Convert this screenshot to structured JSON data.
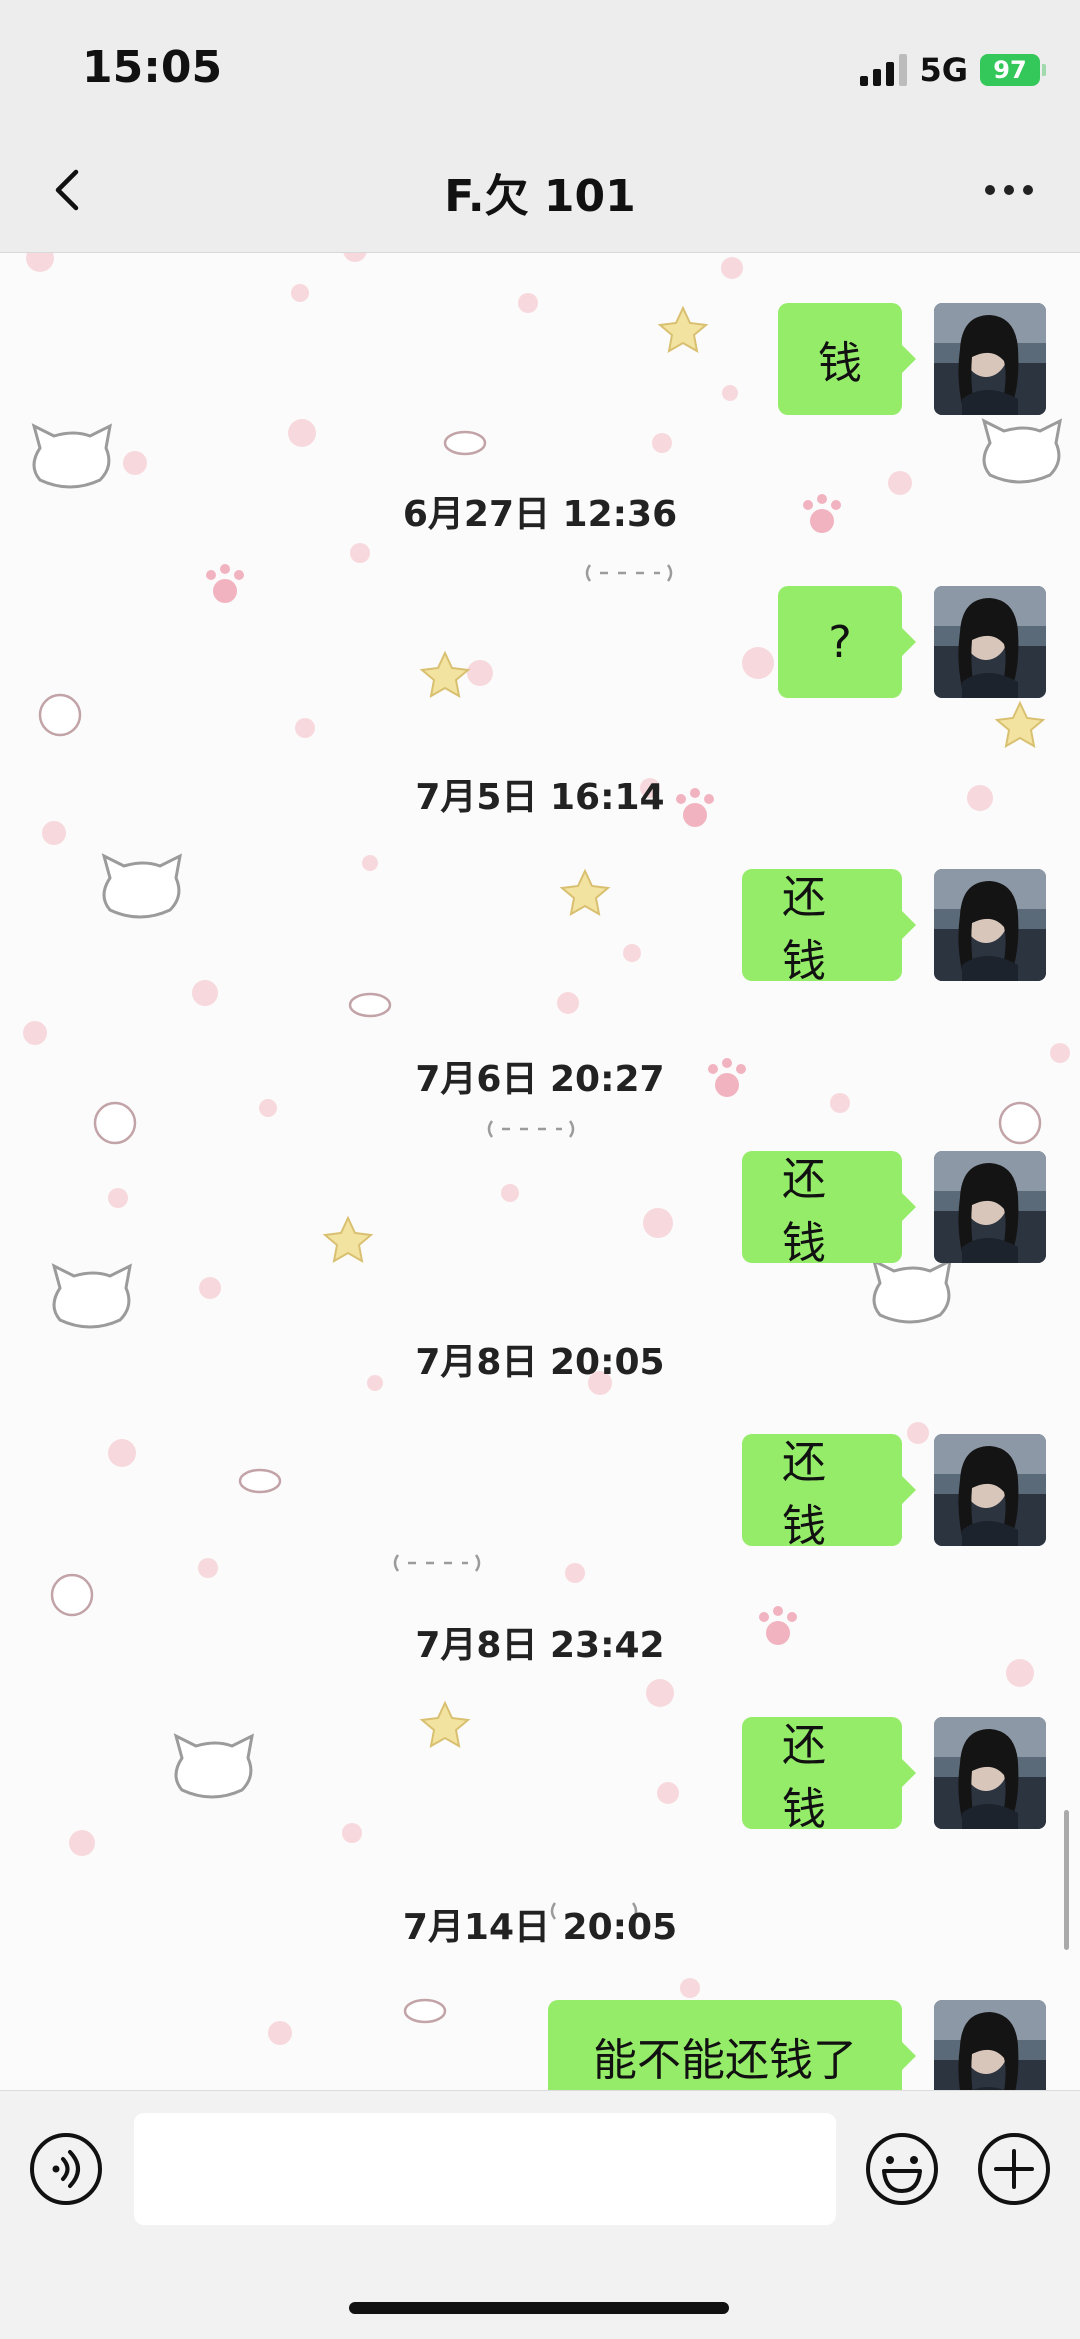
{
  "status": {
    "time": "15:05",
    "network": "5G",
    "battery": "97"
  },
  "header": {
    "title": "F.欠 101"
  },
  "messages": [
    {
      "type": "out",
      "text": "钱"
    },
    {
      "type": "time",
      "text": "6月27日 12:36"
    },
    {
      "type": "out",
      "text": "?"
    },
    {
      "type": "time",
      "text": "7月5日 16:14"
    },
    {
      "type": "out",
      "text": "还钱"
    },
    {
      "type": "time",
      "text": "7月6日 20:27"
    },
    {
      "type": "out",
      "text": "还钱"
    },
    {
      "type": "time",
      "text": "7月8日 20:05"
    },
    {
      "type": "out",
      "text": "还钱"
    },
    {
      "type": "time",
      "text": "7月8日 23:42"
    },
    {
      "type": "out",
      "text": "还钱"
    },
    {
      "type": "time",
      "text": "7月14日 20:05"
    },
    {
      "type": "out",
      "text": "能不能还钱了"
    }
  ],
  "colors": {
    "bubble": "#95ec69",
    "nav": "#ededed",
    "battery": "#34c759"
  },
  "icons": [
    "back-chevron-icon",
    "more-dots-icon",
    "voice-icon",
    "emoji-icon",
    "plus-icon",
    "signal-icon",
    "battery-icon"
  ]
}
